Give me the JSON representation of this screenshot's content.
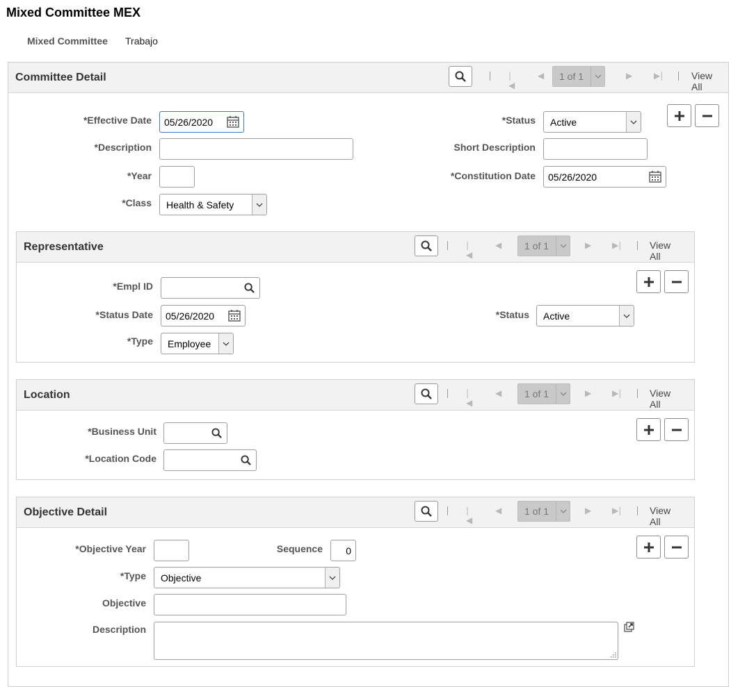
{
  "page": {
    "title": "Mixed Committee MEX"
  },
  "header": {
    "label": "Mixed Committee",
    "value": "Trabajo"
  },
  "colors": {
    "section_header_bg": "#f2f2f2",
    "focus_border": "#3c79c4",
    "pager_bg": "#c9c9c9"
  },
  "nav": {
    "pager": "1 of 1",
    "view_all": "View All"
  },
  "committee": {
    "title": "Committee Detail",
    "effective_date": {
      "label": "*Effective Date",
      "value": "05/26/2020"
    },
    "description": {
      "label": "*Description",
      "value": ""
    },
    "year": {
      "label": "*Year",
      "value": ""
    },
    "class": {
      "label": "*Class",
      "value": "Health & Safety"
    },
    "status": {
      "label": "*Status",
      "value": "Active"
    },
    "short_description": {
      "label": "Short Description",
      "value": ""
    },
    "constitution_date": {
      "label": "*Constitution Date",
      "value": "05/26/2020"
    }
  },
  "representative": {
    "title": "Representative",
    "empl_id": {
      "label": "*Empl ID",
      "value": ""
    },
    "status_date": {
      "label": "*Status Date",
      "value": "05/26/2020"
    },
    "type": {
      "label": "*Type",
      "value": "Employee"
    },
    "status": {
      "label": "*Status",
      "value": "Active"
    }
  },
  "location": {
    "title": "Location",
    "business_unit": {
      "label": "*Business Unit",
      "value": ""
    },
    "location_code": {
      "label": "*Location Code",
      "value": ""
    }
  },
  "objective": {
    "title": "Objective Detail",
    "objective_year": {
      "label": "*Objective Year",
      "value": ""
    },
    "sequence": {
      "label": "Sequence",
      "value": "0"
    },
    "type": {
      "label": "*Type",
      "value": "Objective"
    },
    "objective": {
      "label": "Objective",
      "value": ""
    },
    "description": {
      "label": "Description",
      "value": ""
    }
  },
  "icons": [
    "search-icon",
    "first-icon",
    "prev-icon",
    "next-icon",
    "last-icon",
    "calendar-icon",
    "chevron-down-icon",
    "plus-icon",
    "minus-icon",
    "expand-icon",
    "resize-grip-icon"
  ]
}
